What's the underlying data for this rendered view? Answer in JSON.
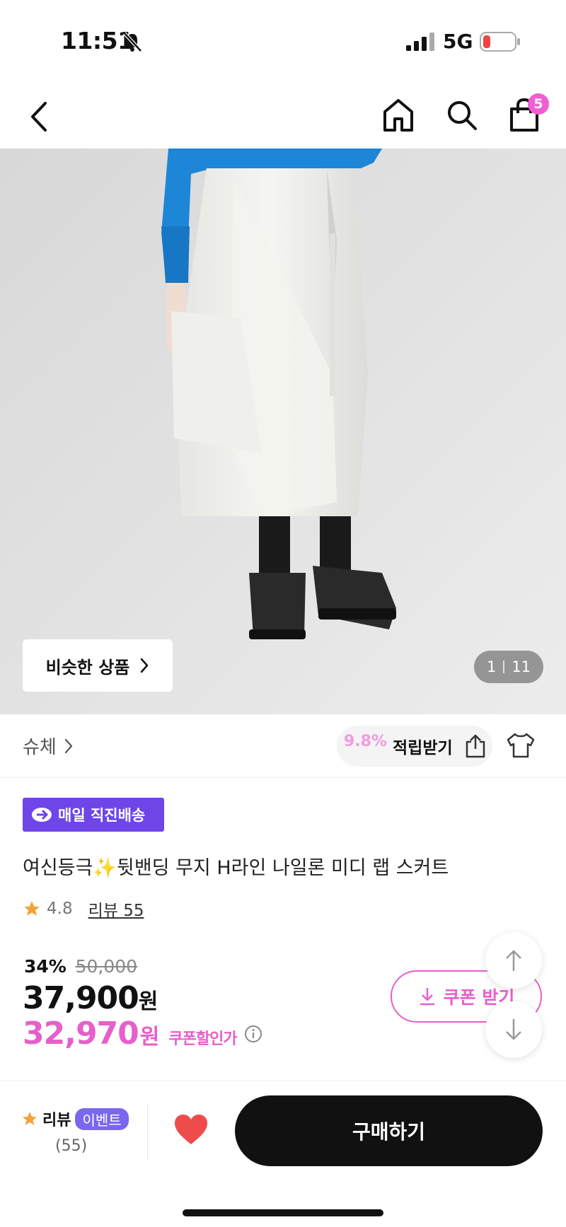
{
  "status_bar": {
    "time": "11:51",
    "network": "5G",
    "colors": {
      "battery_low": "#ef4444"
    }
  },
  "nav": {
    "cart_count": "5",
    "icons": [
      "back-icon",
      "home-icon",
      "search-icon",
      "shopping-bag-icon"
    ]
  },
  "gallery": {
    "similar_label": "비슷한 상품",
    "current": "1",
    "total": "11"
  },
  "brand": {
    "name": "슈체",
    "points_percent": "9.8%",
    "points_label": "적립받기"
  },
  "product": {
    "delivery_badge": "매일 직진배송",
    "title": "여신등극✨뒷밴딩 무지 H라인 나일론 미디 랩 스커트",
    "rating": "4.8",
    "reviews_link": "리뷰 55",
    "discount_rate": "34%",
    "original_price": "50,000",
    "price": "37,900",
    "price_unit": "원",
    "coupon_price": "32,970",
    "coupon_caption": "쿠폰할인가",
    "coupon_button": "쿠폰 받기"
  },
  "bottom_bar": {
    "review_label": "리뷰",
    "event_label": "이벤트",
    "review_count": "(55)",
    "buy_label": "구매하기"
  },
  "colors": {
    "accent_pink": "#e65fcb",
    "delivery_purple": "#6e46e8",
    "heart_red": "#ee4b4b"
  }
}
